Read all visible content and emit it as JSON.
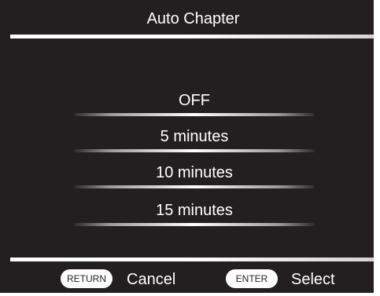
{
  "dialog": {
    "title": "Auto Chapter"
  },
  "menu": {
    "items": [
      {
        "label": "OFF"
      },
      {
        "label": "5 minutes"
      },
      {
        "label": "10 minutes"
      },
      {
        "label": "15 minutes"
      }
    ]
  },
  "footer": {
    "return_key": "RETURN",
    "return_action": "Cancel",
    "enter_key": "ENTER",
    "enter_action": "Select"
  },
  "colors": {
    "background": "#231f20",
    "text": "#ffffff",
    "rule": "#ffffff"
  }
}
